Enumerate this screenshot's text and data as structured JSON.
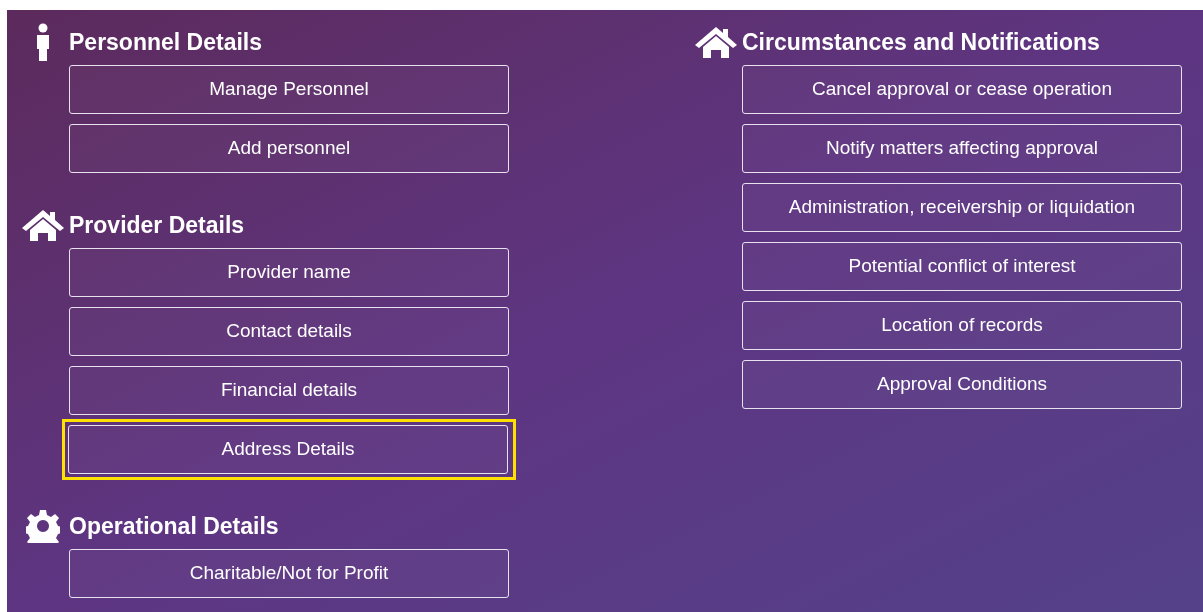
{
  "columns": [
    {
      "sections": [
        {
          "title": "Personnel Details",
          "buttons": [
            {
              "label": "Manage Personnel",
              "highlighted": false
            },
            {
              "label": "Add personnel",
              "highlighted": false
            }
          ]
        },
        {
          "title": "Provider Details",
          "buttons": [
            {
              "label": "Provider name",
              "highlighted": false
            },
            {
              "label": "Contact details",
              "highlighted": false
            },
            {
              "label": "Financial details",
              "highlighted": false
            },
            {
              "label": "Address Details",
              "highlighted": true
            }
          ]
        },
        {
          "title": "Operational Details",
          "buttons": [
            {
              "label": "Charitable/Not for Profit",
              "highlighted": false
            }
          ]
        }
      ]
    },
    {
      "sections": [
        {
          "title": "Circumstances and Notifications",
          "buttons": [
            {
              "label": "Cancel approval or cease operation",
              "highlighted": false
            },
            {
              "label": "Notify matters affecting approval",
              "highlighted": false
            },
            {
              "label": "Administration, receivership or liquidation",
              "highlighted": false
            },
            {
              "label": "Potential conflict of interest",
              "highlighted": false
            },
            {
              "label": "Location of records",
              "highlighted": false
            },
            {
              "label": "Approval Conditions",
              "highlighted": false
            }
          ]
        }
      ]
    }
  ]
}
